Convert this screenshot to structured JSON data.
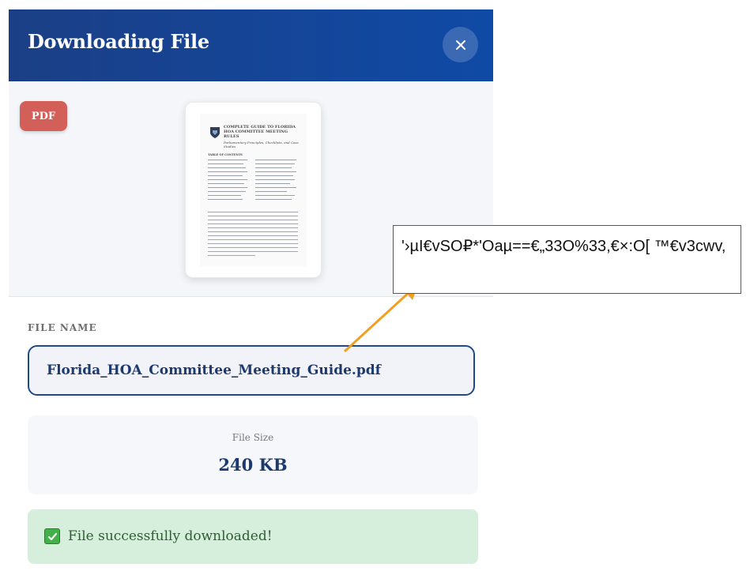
{
  "dialog": {
    "title": "Downloading File",
    "close_icon": "close-icon"
  },
  "preview": {
    "badge": "PDF",
    "document": {
      "title": "COMPLETE GUIDE TO FLORIDA HOA COMMITTEE MEETING RULES",
      "subtitle": "Parliamentary Principles, Checklists, and Case Studies",
      "toc_heading": "TABLE OF CONTENTS"
    }
  },
  "file": {
    "name_label": "FILE NAME",
    "name_value": "Florida_HOA_Committee_Meeting_Guide.pdf",
    "size_label": "File Size",
    "size_value": "240 KB"
  },
  "status": {
    "icon": "check-box-icon",
    "message": "File successfully downloaded!"
  },
  "annotation": {
    "text": "'›µI€vSO₽*'Oaµ==€„33O%33,€×:O[ ™€v3cwv,",
    "border_color": "#e02020",
    "arrow_color": "#f0a020"
  },
  "colors": {
    "header": "#0f4aa6",
    "accent": "#1d3a6e",
    "success_bg": "#d6eedc",
    "badge": "#d35f59"
  }
}
